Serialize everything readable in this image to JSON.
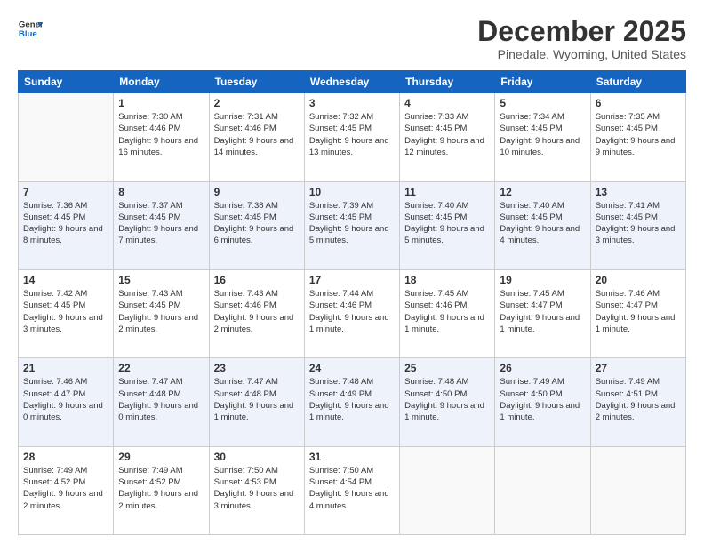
{
  "logo": {
    "line1": "General",
    "line2": "Blue"
  },
  "title": "December 2025",
  "subtitle": "Pinedale, Wyoming, United States",
  "days_header": [
    "Sunday",
    "Monday",
    "Tuesday",
    "Wednesday",
    "Thursday",
    "Friday",
    "Saturday"
  ],
  "weeks": [
    [
      {
        "day": "",
        "sunrise": "",
        "sunset": "",
        "daylight": ""
      },
      {
        "day": "1",
        "sunrise": "Sunrise: 7:30 AM",
        "sunset": "Sunset: 4:46 PM",
        "daylight": "Daylight: 9 hours and 16 minutes."
      },
      {
        "day": "2",
        "sunrise": "Sunrise: 7:31 AM",
        "sunset": "Sunset: 4:46 PM",
        "daylight": "Daylight: 9 hours and 14 minutes."
      },
      {
        "day": "3",
        "sunrise": "Sunrise: 7:32 AM",
        "sunset": "Sunset: 4:45 PM",
        "daylight": "Daylight: 9 hours and 13 minutes."
      },
      {
        "day": "4",
        "sunrise": "Sunrise: 7:33 AM",
        "sunset": "Sunset: 4:45 PM",
        "daylight": "Daylight: 9 hours and 12 minutes."
      },
      {
        "day": "5",
        "sunrise": "Sunrise: 7:34 AM",
        "sunset": "Sunset: 4:45 PM",
        "daylight": "Daylight: 9 hours and 10 minutes."
      },
      {
        "day": "6",
        "sunrise": "Sunrise: 7:35 AM",
        "sunset": "Sunset: 4:45 PM",
        "daylight": "Daylight: 9 hours and 9 minutes."
      }
    ],
    [
      {
        "day": "7",
        "sunrise": "Sunrise: 7:36 AM",
        "sunset": "Sunset: 4:45 PM",
        "daylight": "Daylight: 9 hours and 8 minutes."
      },
      {
        "day": "8",
        "sunrise": "Sunrise: 7:37 AM",
        "sunset": "Sunset: 4:45 PM",
        "daylight": "Daylight: 9 hours and 7 minutes."
      },
      {
        "day": "9",
        "sunrise": "Sunrise: 7:38 AM",
        "sunset": "Sunset: 4:45 PM",
        "daylight": "Daylight: 9 hours and 6 minutes."
      },
      {
        "day": "10",
        "sunrise": "Sunrise: 7:39 AM",
        "sunset": "Sunset: 4:45 PM",
        "daylight": "Daylight: 9 hours and 5 minutes."
      },
      {
        "day": "11",
        "sunrise": "Sunrise: 7:40 AM",
        "sunset": "Sunset: 4:45 PM",
        "daylight": "Daylight: 9 hours and 5 minutes."
      },
      {
        "day": "12",
        "sunrise": "Sunrise: 7:40 AM",
        "sunset": "Sunset: 4:45 PM",
        "daylight": "Daylight: 9 hours and 4 minutes."
      },
      {
        "day": "13",
        "sunrise": "Sunrise: 7:41 AM",
        "sunset": "Sunset: 4:45 PM",
        "daylight": "Daylight: 9 hours and 3 minutes."
      }
    ],
    [
      {
        "day": "14",
        "sunrise": "Sunrise: 7:42 AM",
        "sunset": "Sunset: 4:45 PM",
        "daylight": "Daylight: 9 hours and 3 minutes."
      },
      {
        "day": "15",
        "sunrise": "Sunrise: 7:43 AM",
        "sunset": "Sunset: 4:45 PM",
        "daylight": "Daylight: 9 hours and 2 minutes."
      },
      {
        "day": "16",
        "sunrise": "Sunrise: 7:43 AM",
        "sunset": "Sunset: 4:46 PM",
        "daylight": "Daylight: 9 hours and 2 minutes."
      },
      {
        "day": "17",
        "sunrise": "Sunrise: 7:44 AM",
        "sunset": "Sunset: 4:46 PM",
        "daylight": "Daylight: 9 hours and 1 minute."
      },
      {
        "day": "18",
        "sunrise": "Sunrise: 7:45 AM",
        "sunset": "Sunset: 4:46 PM",
        "daylight": "Daylight: 9 hours and 1 minute."
      },
      {
        "day": "19",
        "sunrise": "Sunrise: 7:45 AM",
        "sunset": "Sunset: 4:47 PM",
        "daylight": "Daylight: 9 hours and 1 minute."
      },
      {
        "day": "20",
        "sunrise": "Sunrise: 7:46 AM",
        "sunset": "Sunset: 4:47 PM",
        "daylight": "Daylight: 9 hours and 1 minute."
      }
    ],
    [
      {
        "day": "21",
        "sunrise": "Sunrise: 7:46 AM",
        "sunset": "Sunset: 4:47 PM",
        "daylight": "Daylight: 9 hours and 0 minutes."
      },
      {
        "day": "22",
        "sunrise": "Sunrise: 7:47 AM",
        "sunset": "Sunset: 4:48 PM",
        "daylight": "Daylight: 9 hours and 0 minutes."
      },
      {
        "day": "23",
        "sunrise": "Sunrise: 7:47 AM",
        "sunset": "Sunset: 4:48 PM",
        "daylight": "Daylight: 9 hours and 1 minute."
      },
      {
        "day": "24",
        "sunrise": "Sunrise: 7:48 AM",
        "sunset": "Sunset: 4:49 PM",
        "daylight": "Daylight: 9 hours and 1 minute."
      },
      {
        "day": "25",
        "sunrise": "Sunrise: 7:48 AM",
        "sunset": "Sunset: 4:50 PM",
        "daylight": "Daylight: 9 hours and 1 minute."
      },
      {
        "day": "26",
        "sunrise": "Sunrise: 7:49 AM",
        "sunset": "Sunset: 4:50 PM",
        "daylight": "Daylight: 9 hours and 1 minute."
      },
      {
        "day": "27",
        "sunrise": "Sunrise: 7:49 AM",
        "sunset": "Sunset: 4:51 PM",
        "daylight": "Daylight: 9 hours and 2 minutes."
      }
    ],
    [
      {
        "day": "28",
        "sunrise": "Sunrise: 7:49 AM",
        "sunset": "Sunset: 4:52 PM",
        "daylight": "Daylight: 9 hours and 2 minutes."
      },
      {
        "day": "29",
        "sunrise": "Sunrise: 7:49 AM",
        "sunset": "Sunset: 4:52 PM",
        "daylight": "Daylight: 9 hours and 2 minutes."
      },
      {
        "day": "30",
        "sunrise": "Sunrise: 7:50 AM",
        "sunset": "Sunset: 4:53 PM",
        "daylight": "Daylight: 9 hours and 3 minutes."
      },
      {
        "day": "31",
        "sunrise": "Sunrise: 7:50 AM",
        "sunset": "Sunset: 4:54 PM",
        "daylight": "Daylight: 9 hours and 4 minutes."
      },
      {
        "day": "",
        "sunrise": "",
        "sunset": "",
        "daylight": ""
      },
      {
        "day": "",
        "sunrise": "",
        "sunset": "",
        "daylight": ""
      },
      {
        "day": "",
        "sunrise": "",
        "sunset": "",
        "daylight": ""
      }
    ]
  ]
}
